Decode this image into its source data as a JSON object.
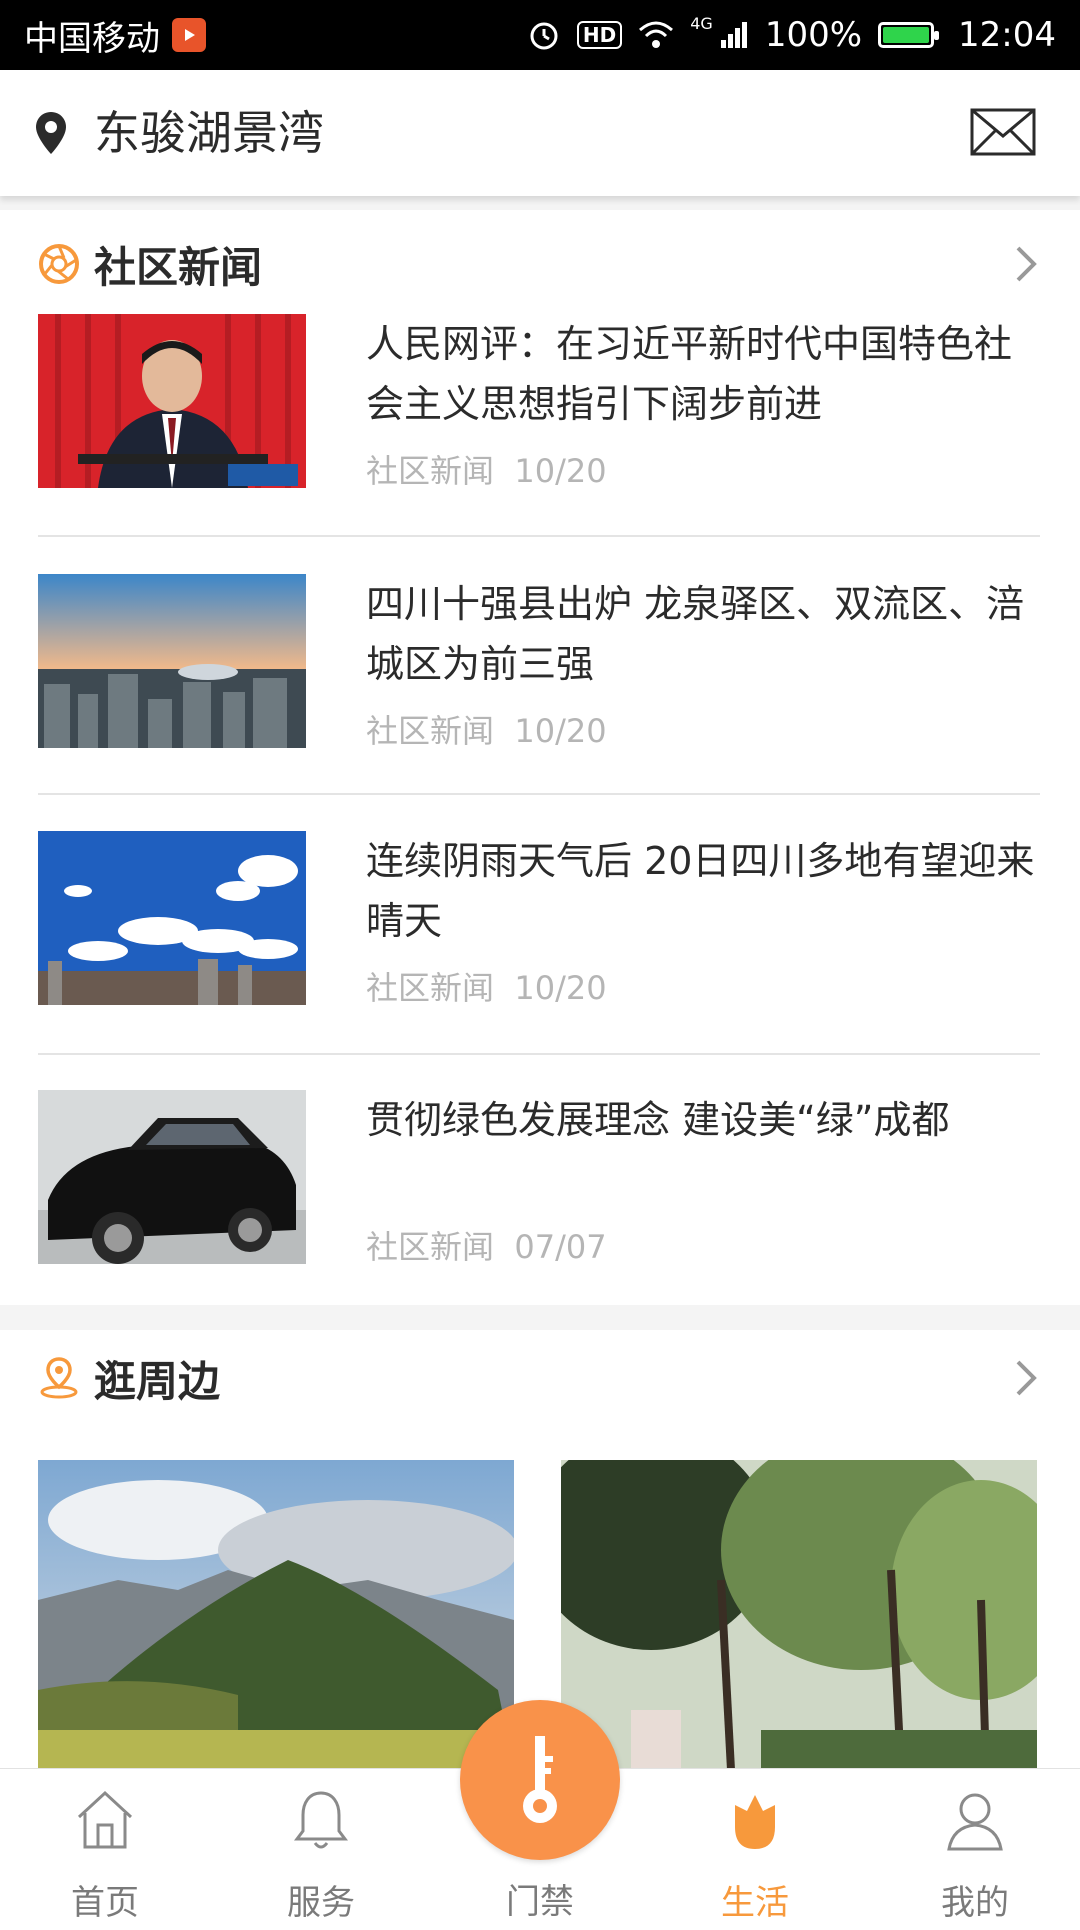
{
  "status_bar": {
    "carrier": "中国移动",
    "network": "4G",
    "battery": "100%",
    "time": "12:04",
    "hd": "HD",
    "battery_level": 1.0
  },
  "header": {
    "location": "东骏湖景湾",
    "location_icon": "map-pin-icon",
    "mail_icon": "envelope-icon"
  },
  "news_section": {
    "title": "社区新闻",
    "items": [
      {
        "title": "人民网评：在习近平新时代中国特色社会主义思想指引下阔步前进",
        "category": "社区新闻",
        "date": "10/20"
      },
      {
        "title": "四川十强县出炉 龙泉驿区、双流区、涪城区为前三强",
        "category": "社区新闻",
        "date": "10/20"
      },
      {
        "title": "连续阴雨天气后 20日四川多地有望迎来晴天",
        "category": "社区新闻",
        "date": "10/20"
      },
      {
        "title": "贯彻绿色发展理念 建设美“绿”成都",
        "category": "社区新闻",
        "date": "07/07"
      }
    ]
  },
  "nearby_section": {
    "title": "逛周边"
  },
  "bottom_nav": {
    "items": [
      {
        "label": "首页",
        "icon": "home-icon"
      },
      {
        "label": "服务",
        "icon": "bell-icon"
      },
      {
        "label": "门禁",
        "icon": "key-icon"
      },
      {
        "label": "生活",
        "icon": "flower-icon",
        "active": true
      },
      {
        "label": "我的",
        "icon": "user-icon"
      }
    ]
  },
  "colors": {
    "accent": "#f7993c",
    "fab": "#f9924a",
    "meta_text": "#b5b5b5"
  }
}
